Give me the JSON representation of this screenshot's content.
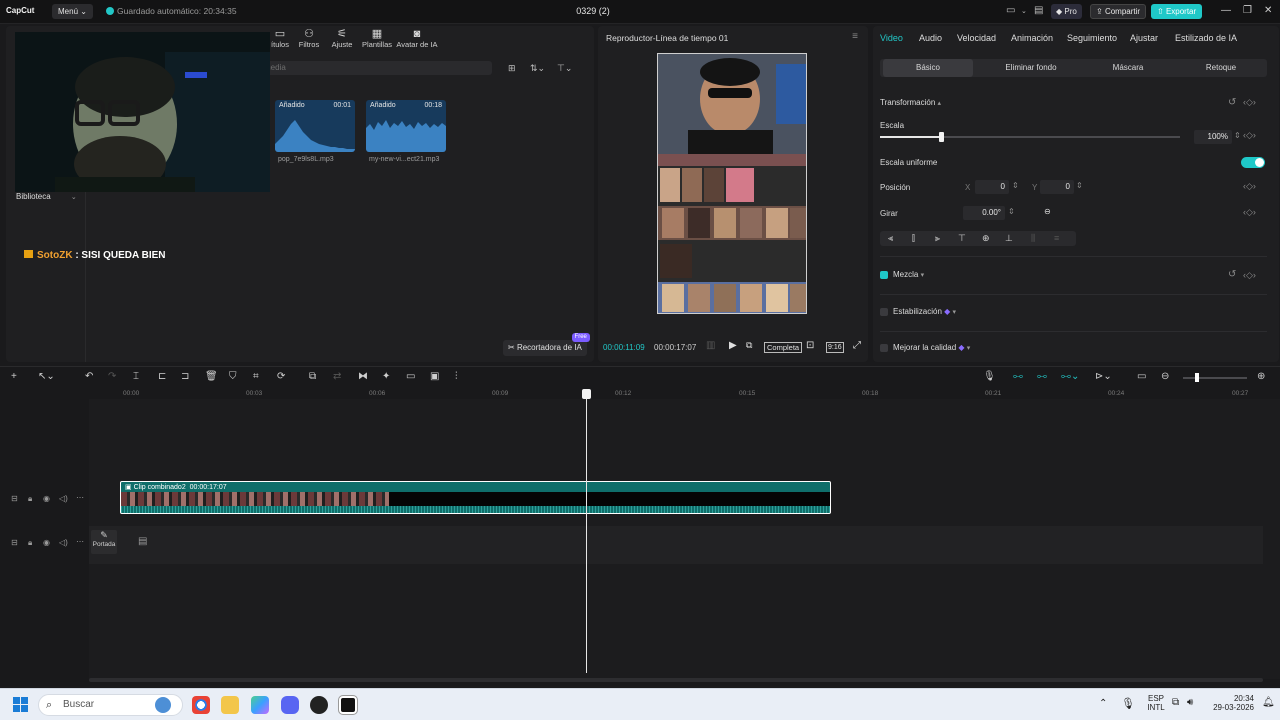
{
  "topbar": {
    "logo": "CapCut",
    "menu": "Menú",
    "autosave": "Guardado automático: 20:34:35",
    "project_title": "0329 (2)",
    "pro": "Pro",
    "share": "Compartir",
    "export": "Exportar"
  },
  "media_panel": {
    "tools": [
      {
        "label": "ítulos",
        "icon": "captions-icon"
      },
      {
        "label": "Filtros",
        "icon": "filters-icon"
      },
      {
        "label": "Ajuste",
        "icon": "adjust-icon"
      },
      {
        "label": "Plantillas",
        "icon": "templates-icon"
      },
      {
        "label": "Avatar de IA",
        "icon": "avatar-icon"
      }
    ],
    "search_placeholder": "media",
    "library": "Biblioteca",
    "cards": [
      {
        "badge": "Añadido",
        "duration": "00:01",
        "name": "pop_7e9ls8L.mp3"
      },
      {
        "badge": "Añadido",
        "duration": "00:18",
        "name": "my-new-vi...ect21.mp3"
      }
    ],
    "ia_button": "Recortadora de IA",
    "ia_badge": "Free"
  },
  "chat": {
    "user": "SotoZK",
    "message": " : SISI QUEDA BIEN"
  },
  "player": {
    "title": "Reproductor-Línea de tiempo 01",
    "current_time": "00:00:11:09",
    "total_time": "00:00:17:07",
    "full_label": "Completa",
    "ratio": "9:16"
  },
  "properties": {
    "tabs": [
      "Video",
      "Audio",
      "Velocidad",
      "Animación",
      "Seguimiento",
      "Ajustar",
      "Estilizado de IA"
    ],
    "subtabs": [
      "Básico",
      "Eliminar fondo",
      "Máscara",
      "Retoque"
    ],
    "transform": "Transformación",
    "scale_label": "Escala",
    "scale_value": "100%",
    "scale_level": 1.0,
    "uniform_scale": "Escala uniforme",
    "position_label": "Posición",
    "x_label": "X",
    "x_value": "0",
    "y_label": "Y",
    "y_value": "0",
    "rotate_label": "Girar",
    "rotate_value": "0.00°",
    "blend": "Mezcla",
    "stabilization": "Estabilización",
    "enhance": "Mejorar la calidad"
  },
  "timeline": {
    "ruler": [
      "00:00",
      "00:03",
      "00:06",
      "00:09",
      "00:12",
      "00:15",
      "00:18",
      "00:21",
      "00:24",
      "00:27"
    ],
    "clip_name": "Clip combinado2",
    "clip_duration": "00:00:17:07",
    "cover_label": "Portada"
  },
  "taskbar": {
    "search": "Buscar",
    "lang_top": "ESP",
    "lang_bottom": "INTL",
    "time": "20:34",
    "date": "29-03-2026"
  },
  "colors": {
    "accent": "#22c7c7",
    "export": "#1fc8c8",
    "clip": "#0f6e6a",
    "chat_user": "#f0a030"
  }
}
